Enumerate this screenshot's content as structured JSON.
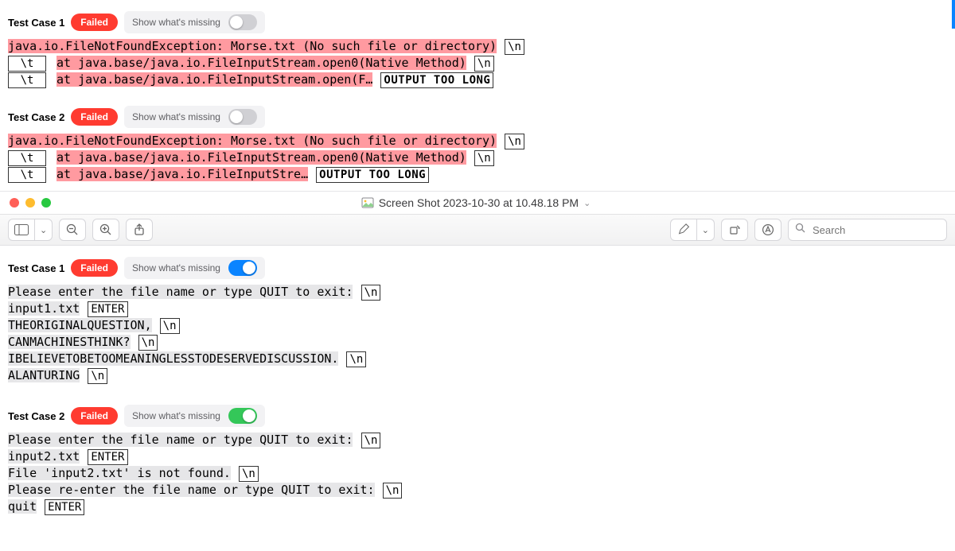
{
  "labels": {
    "failed": "Failed",
    "show_missing": "Show what's missing"
  },
  "upper": {
    "tc1": {
      "title": "Test Case 1",
      "toggle_on": false,
      "line1_a": "java.io.FileNotFoundException: Morse.txt (No such file or directory)",
      "line1_newline": "\\n",
      "tab": "\\t",
      "line2_a": "at java.base/java.io.FileInputStream.open0(Native Method)",
      "line2_newline": "\\n",
      "line3_a": "at java.base/java.io.FileInputStream.open(F…",
      "too_long": "OUTPUT TOO LONG"
    },
    "tc2": {
      "title": "Test Case 2",
      "toggle_on": false,
      "line1_a": "java.io.FileNotFoundException: Morse.txt (No such file or directory)",
      "line1_newline": "\\n",
      "tab": "\\t",
      "line2_a": "at java.base/java.io.FileInputStream.open0(Native Method)",
      "line2_newline": "\\n",
      "line3_a": "at java.base/java.io.FileInputStre…",
      "too_long": "OUTPUT TOO LONG"
    }
  },
  "mac": {
    "title": "Screen Shot 2023-10-30 at 10.48.18 PM",
    "search_placeholder": "Search"
  },
  "lower": {
    "tc1": {
      "title": "Test Case 1",
      "toggle_on": true,
      "l1a": "Please enter the file name or type QUIT to exit:",
      "nl": "\\n",
      "l2a": "input1.txt",
      "enter": "ENTER",
      "l3a": "THEORIGINALQUESTION,",
      "l4a": "CANMACHINESTHINK?",
      "l5a": "IBELIEVETOBETOOMEANINGLESSTODESERVEDISCUSSION.",
      "l6a": "ALANTURING"
    },
    "tc2": {
      "title": "Test Case 2",
      "toggle_on": true,
      "l1a": "Please enter the file name or type QUIT to exit:",
      "nl": "\\n",
      "l2a": "input2.txt",
      "enter": "ENTER",
      "l3a": "File 'input2.txt' is not found.",
      "l4a": "Please re-enter the file name or type QUIT to exit:",
      "l5a": "quit"
    }
  }
}
